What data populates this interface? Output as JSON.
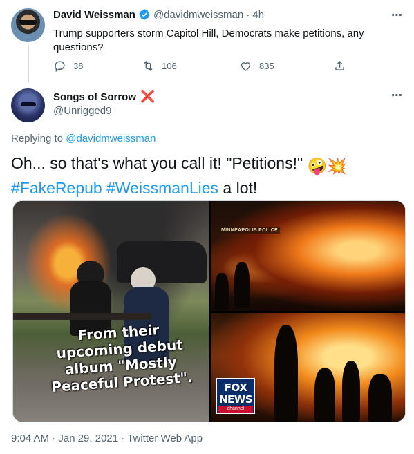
{
  "parent_tweet": {
    "display_name": "David Weissman",
    "handle": "@davidmweissman",
    "time": "· 4h",
    "text": "Trump supporters storm Capitol Hill, Democrats make petitions, any questions?",
    "replies": "38",
    "retweets": "106",
    "likes": "835"
  },
  "main_tweet": {
    "display_name": "Songs of Sorrow",
    "badge": "❌",
    "handle": "@Unrigged9",
    "replying_prefix": "Replying to",
    "replying_to": "@davidmweissman",
    "text_line1": "Oh... so that's what you call it!  \"Petitions!\"",
    "emoji_1": "🤪",
    "emoji_2": "💥",
    "hashtag_1": "#FakeRepub",
    "hashtag_2": "#WeissmanLies",
    "text_line2_tail": "a lot!",
    "image_caption": "From their upcoming debut album \"Mostly Peaceful Protest\".",
    "sign_text": "MINNEAPOLIS POLICE",
    "logo_fox": "FOX",
    "logo_news": "NEWS",
    "logo_channel": "channel",
    "timestamp": "9:04 AM · Jan 29, 2021 · Twitter Web App"
  },
  "menu_icon": "⋯",
  "colors": {
    "link": "#1d9bf0",
    "secondary": "#536471",
    "verified": "#1d9bf0",
    "badge_red": "#e0245e"
  },
  "icons": [
    "reply-icon",
    "retweet-icon",
    "like-icon",
    "share-icon",
    "verified-badge-icon",
    "more-icon"
  ]
}
